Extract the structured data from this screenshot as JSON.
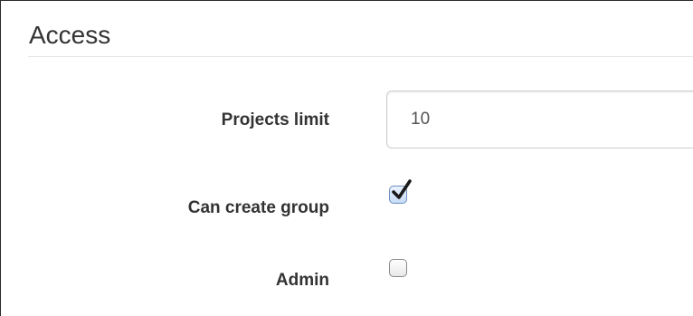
{
  "section": {
    "title": "Access"
  },
  "fields": {
    "projects_limit": {
      "label": "Projects limit",
      "value": "10"
    },
    "can_create_group": {
      "label": "Can create group",
      "checked": true
    },
    "admin": {
      "label": "Admin",
      "checked": false
    }
  },
  "icons": {
    "checkmark": "checkmark-icon"
  },
  "colors": {
    "text": "#333333",
    "input_border": "#cccccc",
    "checkmark": "#1a1a1a"
  }
}
